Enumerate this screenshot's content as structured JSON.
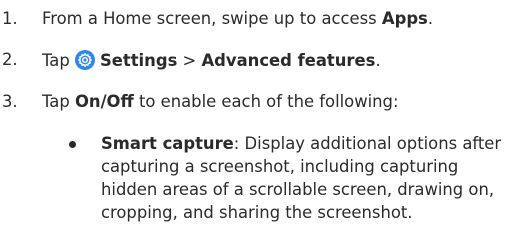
{
  "steps": [
    {
      "number": "1.",
      "text_before": "From a Home screen, swipe up to access ",
      "bold": "Apps",
      "text_after": "."
    },
    {
      "number": "2.",
      "text_before": "Tap ",
      "icon": "settings-gear-icon",
      "bold_a": "Settings",
      "separator": " > ",
      "bold_b": "Advanced features",
      "text_after": "."
    },
    {
      "number": "3.",
      "text_before": "Tap ",
      "bold": "On/Off",
      "text_after": " to enable each of the following:"
    }
  ],
  "bullet": {
    "title": "Smart capture",
    "lines": [
      ": Display additional options after",
      "capturing a screenshot, including capturing",
      "hidden areas of a scrollable screen, drawing on,",
      "cropping, and sharing the screenshot."
    ]
  },
  "colors": {
    "text": "#2b2b2b",
    "settings_icon_bg": "#2f86f0"
  }
}
